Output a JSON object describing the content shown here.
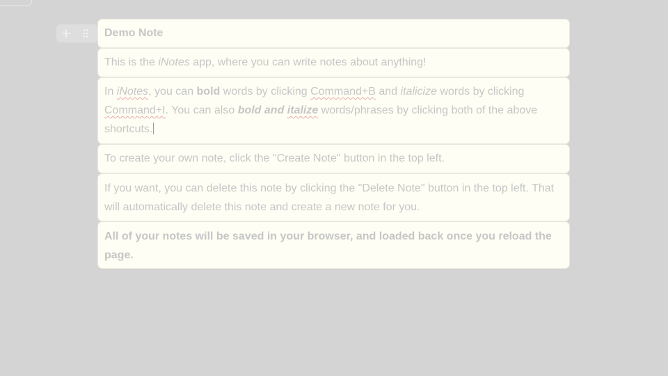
{
  "blocks": {
    "title": "Demo Note",
    "intro": {
      "part1": "This is the ",
      "app_name": "iNotes",
      "part2": " app, where you can write notes about anything!"
    },
    "formatting": {
      "p1": "In ",
      "app_name": "iNotes",
      "p2": ", you can ",
      "bold_word": "bold",
      "p3": " words by clicking ",
      "cmd_b": "Command+B",
      "p4": " and ",
      "italic_word": "italicize",
      "p5": " words by clicking ",
      "cmd_i": "Command+I",
      "p6": ". You can also ",
      "bold_italic_1": "bold and ",
      "bold_italic_2": "italize",
      "p7": " words/phrases by clicking both of the above shortcuts."
    },
    "create_hint": "To create your own note, click the \"Create Note\" button in the top left.",
    "delete_hint": "If you want, you can delete this note by clicking the \"Delete Note\" button in the top left. That will automatically delete this note and create a new note for you.",
    "saved_hint": "All of your notes will be saved in your browser, and loaded back once you reload the page."
  },
  "controls": {
    "add_icon": "plus-icon",
    "drag_icon": "drag-handle-icon"
  },
  "colors": {
    "background": "#d4d4d4",
    "note_background": "#fefef4",
    "text": "#c6c6c6",
    "spellcheck_underline": "#e9a9a9"
  }
}
